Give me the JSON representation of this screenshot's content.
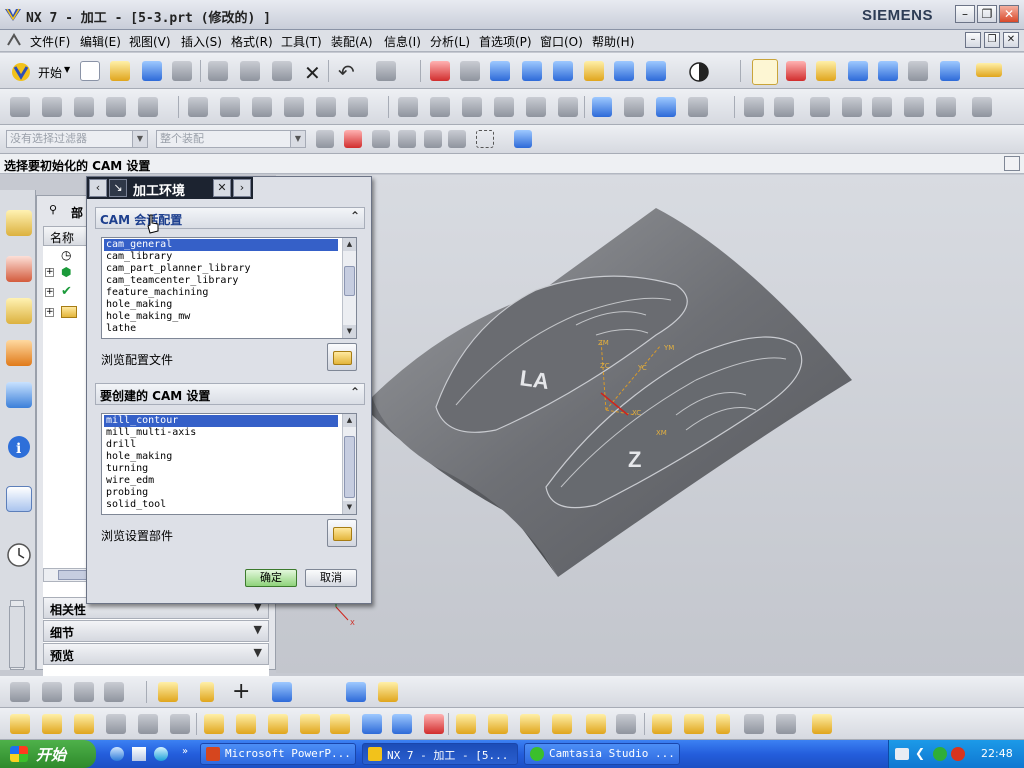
{
  "window": {
    "title": "NX 7 - 加工 - [5-3.prt  (修改的) ]",
    "brand": "SIEMENS"
  },
  "menu": [
    "文件(F)",
    "编辑(E)",
    "视图(V)",
    "插入(S)",
    "格式(R)",
    "工具(T)",
    "装配(A)",
    "信息(I)",
    "分析(L)",
    "首选项(P)",
    "窗口(O)",
    "帮助(H)"
  ],
  "toolbar": {
    "start_label": "开始",
    "filter_placeholder": "没有选择过滤器",
    "assembly_placeholder": "整个装配"
  },
  "cue": "选择要初始化的 CAM 设置",
  "navigator": {
    "title": "部",
    "column": "名称",
    "sections": [
      "相关性",
      "细节",
      "预览"
    ]
  },
  "dialog": {
    "title": "加工环境",
    "config_group": "CAM 会话配置",
    "config_items": [
      "cam_general",
      "cam_library",
      "cam_part_planner_library",
      "cam_teamcenter_library",
      "feature_machining",
      "hole_making",
      "hole_making_mw",
      "lathe"
    ],
    "config_selected": 0,
    "browse_config": "浏览配置文件",
    "setup_group": "要创建的 CAM 设置",
    "setup_items": [
      "mill_contour",
      "mill_multi-axis",
      "drill",
      "hole_making",
      "turning",
      "wire_edm",
      "probing",
      "solid_tool"
    ],
    "setup_selected": 0,
    "browse_setup": "浏览设置部件",
    "ok": "确定",
    "cancel": "取消"
  },
  "taskbar": {
    "start": "开始",
    "tasks": [
      "Microsoft PowerP...",
      "NX 7 - 加工 - [5...",
      "Camtasia Studio ..."
    ],
    "clock": "22:48"
  },
  "model": {
    "labels": [
      "ZM",
      "YM",
      "ZC",
      "YC",
      "XC",
      "XM"
    ],
    "embossed": [
      "LA",
      "Z"
    ],
    "axis_labels": [
      "Y",
      "X"
    ]
  },
  "colors": {
    "accent": "#3560c8",
    "titlebar_dark": "#1c2330",
    "ok_green": "#8fd37b"
  }
}
